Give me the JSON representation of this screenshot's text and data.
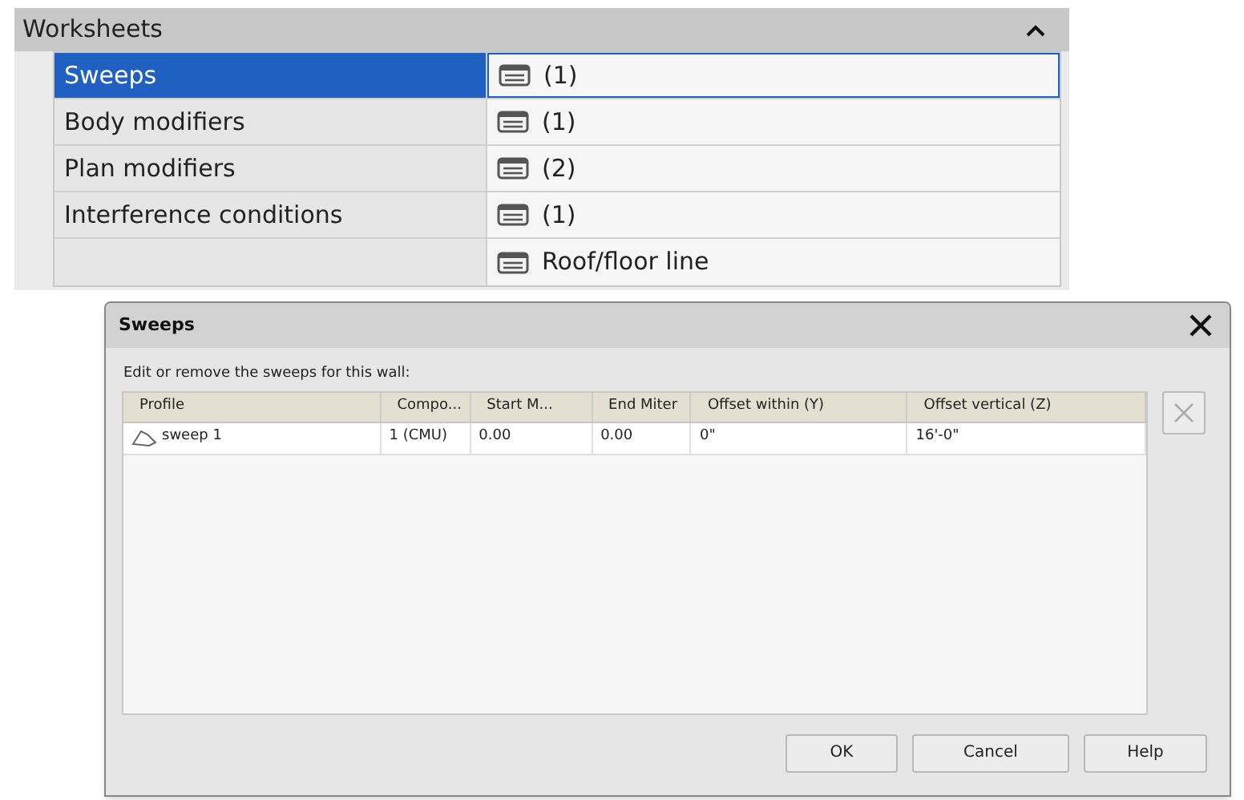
{
  "worksheets": {
    "title": "Worksheets",
    "expanded": true,
    "rows": [
      {
        "label": "Sweeps",
        "value": "(1)",
        "selected": true
      },
      {
        "label": "Body modifiers",
        "value": "(1)",
        "selected": false
      },
      {
        "label": "Plan modifiers",
        "value": "(2)",
        "selected": false
      },
      {
        "label": "Interference conditions",
        "value": "(1)",
        "selected": false
      },
      {
        "label": "",
        "value": "Roof/floor line",
        "selected": false
      }
    ]
  },
  "dialog": {
    "title": "Sweeps",
    "instruction": "Edit or remove the sweeps for this wall:",
    "columns": [
      "Profile",
      "Compo...",
      "Start M...",
      "End Miter",
      "Offset within (Y)",
      "Offset vertical (Z)"
    ],
    "rows": [
      {
        "cells": [
          "sweep 1",
          "1 (CMU)",
          "0.00",
          "0.00",
          "0\"",
          "16'-0\""
        ],
        "selected": false
      }
    ],
    "buttons": [
      "OK",
      "Cancel",
      "Help"
    ]
  }
}
